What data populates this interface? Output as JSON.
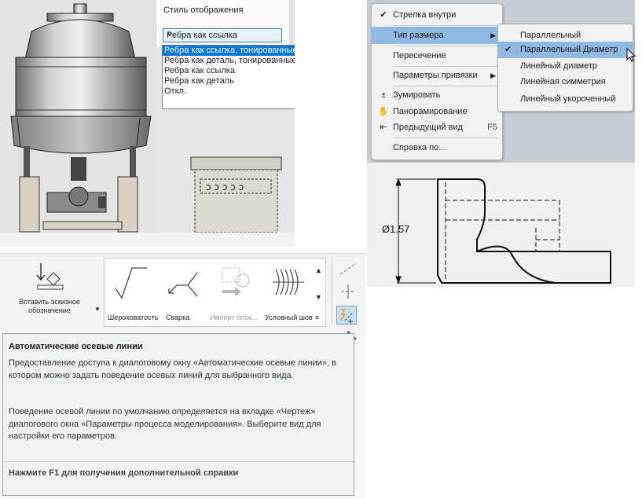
{
  "display_style": {
    "label": "Стиль отображения",
    "selected": "Ребра как ссылка",
    "options": [
      "Ребра как ссылка, тонированные",
      "Ребра как деталь, тонированные",
      "Ребра как ссылка",
      "Ребра как деталь",
      "Откл."
    ]
  },
  "context_menu": {
    "items": [
      {
        "label": "Стрелка внутри",
        "icon": "checkmark-icon"
      },
      {
        "label": "Тип размера",
        "icon": "",
        "submenu": true
      },
      {
        "label": "Пересечение",
        "icon": ""
      },
      {
        "label": "Параметры привязки",
        "icon": "",
        "submenu": true
      },
      {
        "label": "Зумировать",
        "icon": "zoom-icon"
      },
      {
        "label": "Панорамирование",
        "icon": "pan-hand-icon"
      },
      {
        "label": "Предыдущий вид",
        "icon": "previous-view-icon",
        "shortcut": "F5"
      },
      {
        "label": "Справка по...",
        "icon": ""
      }
    ],
    "submenu": [
      "Параллельный",
      "Параллельный Диаметр",
      "Линейный диаметр",
      "Линейная симметрия",
      "Линейный укороченный"
    ],
    "submenu_checked": "Параллельный Диаметр"
  },
  "drawing": {
    "dimension_label": "Ø1.57"
  },
  "ribbon": {
    "insert_sketch_label": "Вставить эскизное обозначение",
    "gallery": [
      {
        "label": "Шероховатость",
        "enabled": true
      },
      {
        "label": "Сварка",
        "enabled": true
      },
      {
        "label": "Импорт блок...",
        "enabled": false
      },
      {
        "label": "Условный шов",
        "enabled": true
      }
    ]
  },
  "tooltip": {
    "title": "Автоматические осевые линии",
    "paragraph1": "Предоставление доступа к диалоговому окну «Автоматические осевые линии», в котором можно задать поведение осевых линий для выбранного вида.",
    "paragraph2": "Поведение осевой линии по умолчанию определяется на вкладке «Чертеж» диалогового окна «Параметры процесса моделирования». Выберите вид для настройки его параметров.",
    "footer": "Нажмите F1 для получения дополнительной справки"
  },
  "colors": {
    "selection": "#0078d7",
    "menu_highlight": "#8fb9e2",
    "combo_border": "#3c7fb1"
  }
}
